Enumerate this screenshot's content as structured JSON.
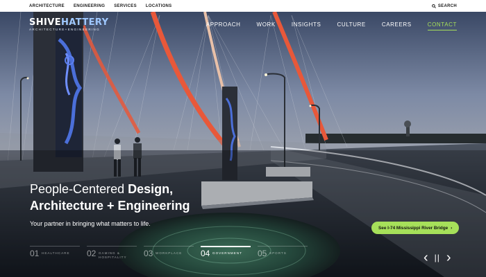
{
  "topbar": {
    "links": [
      "ARCHITECTURE",
      "ENGINEERING",
      "SERVICES",
      "LOCATIONS"
    ],
    "search_label": "SEARCH"
  },
  "logo": {
    "word_a": "SHIVE",
    "word_b": "HATTERY",
    "tagline": "ARCHITECTURE+ENGINEERING"
  },
  "nav": {
    "items": [
      "APPROACH",
      "WORK",
      "INSIGHTS",
      "CULTURE",
      "CAREERS",
      "CONTACT"
    ],
    "active": "CONTACT"
  },
  "hero": {
    "headline_prefix": "People-Centered ",
    "headline_bold_1": "Design,",
    "headline_bold_2": "Architecture + Engineering",
    "subtitle": "Your partner in bringing what matters to life.",
    "caption": "See I-74 Mississippi River Bridge",
    "caption_arrow": "›"
  },
  "categories": [
    {
      "num": "01",
      "label": "HEALTHCARE",
      "active": false
    },
    {
      "num": "02",
      "label": "GAMING & HOSPITALITY",
      "active": false
    },
    {
      "num": "03",
      "label": "WORKPLACE",
      "active": false
    },
    {
      "num": "04",
      "label": "GOVERNMENT",
      "active": true
    },
    {
      "num": "05",
      "label": "SPORTS",
      "active": false
    }
  ],
  "controls": {
    "prev": "‹",
    "pause": "||",
    "next": "›"
  },
  "colors": {
    "accent": "#a6e05a",
    "topbar_bg": "#ffffff",
    "arch": "#e8583a",
    "panel_glow": "#4b6fd9"
  },
  "icons": [
    "search-icon",
    "chevron-right-icon",
    "chevron-left-icon",
    "pause-icon"
  ]
}
